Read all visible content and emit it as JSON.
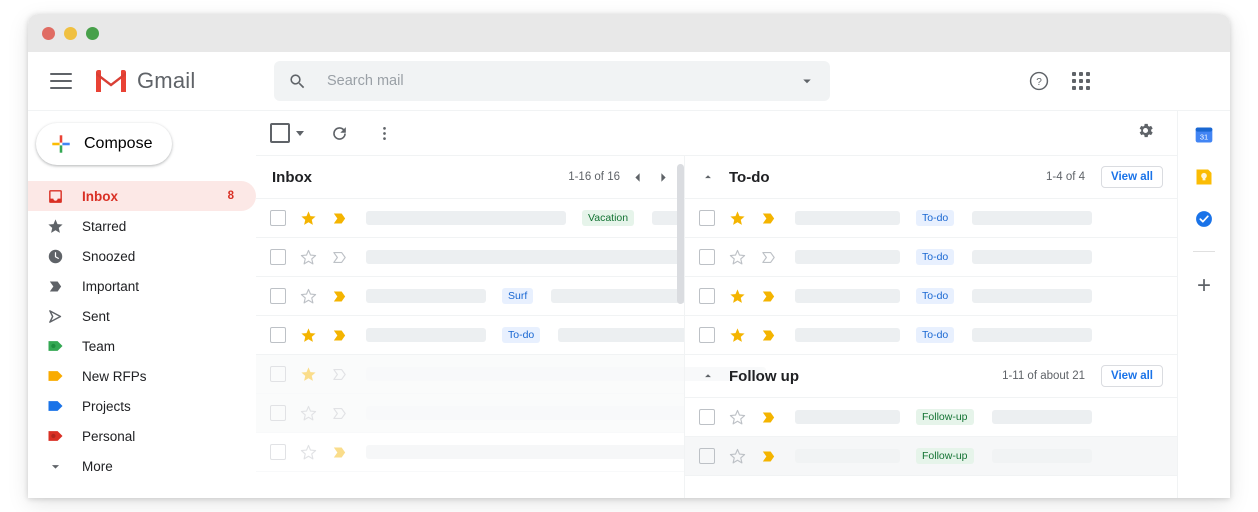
{
  "window": {
    "traffic_lights": [
      "close",
      "minimize",
      "maximize"
    ]
  },
  "header": {
    "menu_icon": "hamburger-icon",
    "brand": "Gmail",
    "search": {
      "placeholder": "Search mail",
      "value": "",
      "icon": "search-icon",
      "options_icon": "chevron-down-icon"
    },
    "help_icon": "help-icon",
    "apps_icon": "apps-grid-icon"
  },
  "sidebar": {
    "compose": {
      "label": "Compose",
      "icon": "plus-icon"
    },
    "items": [
      {
        "label": "Inbox",
        "icon": "inbox-icon",
        "count": "8",
        "active": true
      },
      {
        "label": "Starred",
        "icon": "star-icon",
        "count": "",
        "active": false
      },
      {
        "label": "Snoozed",
        "icon": "clock-icon",
        "count": "",
        "active": false
      },
      {
        "label": "Important",
        "icon": "important-icon",
        "count": "",
        "active": false
      },
      {
        "label": "Sent",
        "icon": "send-icon",
        "count": "",
        "active": false
      },
      {
        "label": "Team",
        "icon": "label-icon",
        "count": "",
        "active": false,
        "color": "#34a853"
      },
      {
        "label": "New RFPs",
        "icon": "label-icon",
        "count": "",
        "active": false,
        "color": "#f9ab00"
      },
      {
        "label": "Projects",
        "icon": "label-icon",
        "count": "",
        "active": false,
        "color": "#1a73e8"
      },
      {
        "label": "Personal",
        "icon": "label-icon",
        "count": "",
        "active": false,
        "color": "#d93025"
      },
      {
        "label": "More",
        "icon": "chevron-down-icon",
        "count": "",
        "active": false
      }
    ]
  },
  "toolbar": {
    "select_all_icon": "checkbox-icon",
    "select_all_caret_icon": "caret-down-icon",
    "refresh_icon": "refresh-icon",
    "more_icon": "more-vertical-icon",
    "settings_icon": "gear-icon"
  },
  "inbox_pane": {
    "title": "Inbox",
    "count": "1-16 of 16",
    "prev_icon": "chevron-left-icon",
    "next_icon": "chevron-right-icon",
    "rows": [
      {
        "starred": true,
        "important": true,
        "read": false,
        "faded": false,
        "chip": "Vacation",
        "chip_color": "green",
        "bar1": 200,
        "bar2": 130
      },
      {
        "starred": false,
        "important": false,
        "read": false,
        "faded": false,
        "chip": "",
        "chip_color": "",
        "bar1": 400,
        "bar2": 0
      },
      {
        "starred": false,
        "important": true,
        "read": false,
        "faded": false,
        "chip": "Surf",
        "chip_color": "blue",
        "bar1": 120,
        "bar2": 175
      },
      {
        "starred": true,
        "important": true,
        "read": false,
        "faded": false,
        "chip": "To-do",
        "chip_color": "blue",
        "bar1": 120,
        "bar2": 165
      },
      {
        "starred": true,
        "important": false,
        "read": true,
        "faded": true,
        "chip": "",
        "chip_color": "",
        "bar1": 400,
        "bar2": 0
      },
      {
        "starred": false,
        "important": false,
        "read": true,
        "faded": true,
        "chip": "",
        "chip_color": "",
        "bar1": 400,
        "bar2": 0
      },
      {
        "starred": false,
        "important": true,
        "read": false,
        "faded": true,
        "chip": "",
        "chip_color": "",
        "bar1": 400,
        "bar2": 0
      }
    ]
  },
  "todo_pane": {
    "title": "To-do",
    "count": "1-4 of 4",
    "view_all": "View all",
    "collapse_icon": "chevron-up-icon",
    "rows": [
      {
        "starred": true,
        "important": true,
        "read": false,
        "chip": "To-do",
        "chip_color": "blue",
        "bar1": 105,
        "bar2": 120
      },
      {
        "starred": false,
        "important": false,
        "read": false,
        "chip": "To-do",
        "chip_color": "blue",
        "bar1": 105,
        "bar2": 120
      },
      {
        "starred": true,
        "important": true,
        "read": false,
        "chip": "To-do",
        "chip_color": "blue",
        "bar1": 105,
        "bar2": 120
      },
      {
        "starred": true,
        "important": true,
        "read": false,
        "chip": "To-do",
        "chip_color": "blue",
        "bar1": 105,
        "bar2": 120
      }
    ]
  },
  "followup_pane": {
    "title": "Follow up",
    "count": "1-11 of about 21",
    "view_all": "View all",
    "collapse_icon": "chevron-up-icon",
    "rows": [
      {
        "starred": false,
        "important": true,
        "read": false,
        "chip": "Follow-up",
        "chip_color": "green",
        "bar1": 105,
        "bar2": 100
      },
      {
        "starred": false,
        "important": true,
        "read": true,
        "chip": "Follow-up",
        "chip_color": "green",
        "bar1": 105,
        "bar2": 100
      }
    ]
  },
  "rail": {
    "items": [
      {
        "icon": "google-calendar-icon",
        "label": "31"
      },
      {
        "icon": "google-keep-icon",
        "label": ""
      },
      {
        "icon": "google-tasks-icon",
        "label": ""
      }
    ],
    "add_icon": "plus-icon"
  },
  "colors": {
    "brand_red": "#d93025",
    "accent_blue": "#1a73e8",
    "chip_blue_bg": "#e8f0fe",
    "chip_blue_fg": "#1967d2",
    "chip_green_bg": "#e6f4ea",
    "chip_green_fg": "#137333",
    "star_gold": "#f4b400",
    "active_bg": "#fce8e6"
  }
}
